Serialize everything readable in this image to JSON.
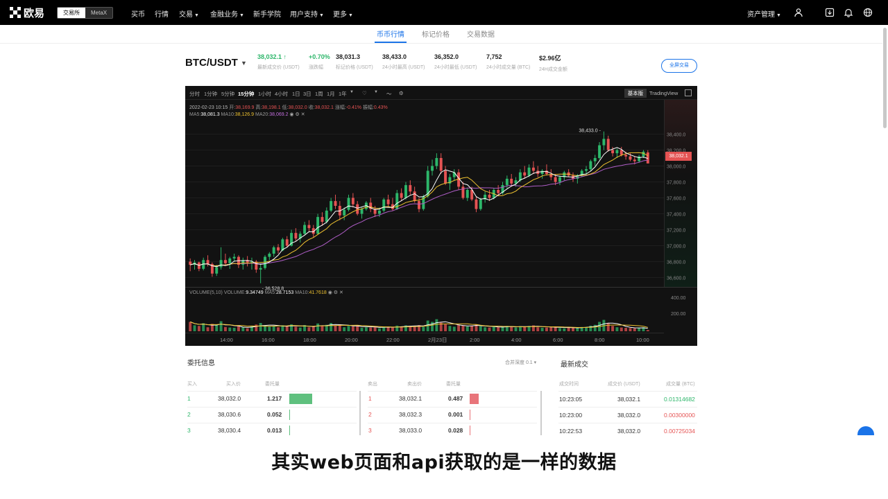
{
  "topnav": {
    "logo_text": "欧易",
    "switch": {
      "active": "交易所",
      "inactive": "MetaX"
    },
    "items": [
      "买币",
      "行情",
      "交易",
      "金融业务",
      "新手学院",
      "用户支持",
      "更多"
    ],
    "right_label": "资产管理",
    "icons": [
      "user-icon",
      "download-icon",
      "bell-icon",
      "globe-icon"
    ]
  },
  "subtabs": [
    "币币行情",
    "标记价格",
    "交易数据"
  ],
  "ticker": {
    "pair": "BTC/USDT",
    "last_price": "38,032.1 ↑",
    "last_price_label": "最新成交价 (USDT)",
    "change": "+0.70%",
    "change_label": "涨跌幅",
    "mark_price": "38,031.3",
    "mark_price_label": "标记价格 (USDT)",
    "high": "38,433.0",
    "high_label": "24小时最高 (USDT)",
    "low": "36,352.0",
    "low_label": "24小时最低 (USDT)",
    "volume_btc": "7,752",
    "volume_btc_label": "24小时成交量 (BTC)",
    "turnover": "$2.96亿",
    "turnover_label": "24H成交金额",
    "fullscreen_label": "全屏交易"
  },
  "chart": {
    "intervals": [
      "分时",
      "1分钟",
      "5分钟",
      "15分钟",
      "1小时",
      "4小时",
      "1日",
      "3日",
      "1周",
      "1月",
      "1年"
    ],
    "active_interval": "15分钟",
    "basic_label": "基本版",
    "tv_label": "TradingView",
    "ohlc_line": {
      "date": "2022-02-23 10:15",
      "open_label": "开:",
      "open": "38,169.9",
      "high_label": "高:",
      "high": "38,198.1",
      "low_label": "低:",
      "low": "38,032.0",
      "close_label": "收:",
      "close": "38,032.1",
      "chg_label": "涨幅:",
      "chg": "-0.41%",
      "amp_label": "振幅:",
      "amp": "0.43%"
    },
    "ma_line": {
      "ma5_label": "MA5:",
      "ma5": "38,081.3",
      "ma10_label": "MA10:",
      "ma10": "38,126.9",
      "ma20_label": "MA20:",
      "ma20": "38,069.2"
    },
    "vol_line": {
      "title": "VOLUME(5,10)",
      "vol_label": "VOLUME:",
      "vol": "9.34749",
      "ma5_label": "MA5:",
      "ma5": "28.7153",
      "ma10_label": "MA10:",
      "ma10": "41.7618"
    },
    "high_marker": "38,433.0",
    "low_marker": "36,528.8",
    "price_flag": "38,032.1",
    "colors": {
      "up": "#2db66a",
      "down": "#e55353",
      "ma5": "#ffffff",
      "ma10": "#f0c330",
      "ma20": "#b05ec8"
    }
  },
  "chart_data": {
    "type": "candlestick",
    "title": "",
    "price_axis_ticks": [
      "38,400.0",
      "38,200.0",
      "38,000.0",
      "37,800.0",
      "37,600.0",
      "37,400.0",
      "37,200.0",
      "37,000.0",
      "36,800.0",
      "36,600.0"
    ],
    "price_range": [
      36500,
      38500
    ],
    "volume_axis_ticks": [
      "400.00",
      "200.00"
    ],
    "volume_range": [
      0,
      500
    ],
    "time_axis_ticks": [
      "14:00",
      "16:00",
      "18:00",
      "20:00",
      "22:00",
      "2月23日",
      "2:00",
      "4:00",
      "6:00",
      "8:00",
      "10:00"
    ],
    "candles": [
      [
        36800,
        36840,
        36680,
        36760,
        70
      ],
      [
        36760,
        36820,
        36700,
        36790,
        45
      ],
      [
        36790,
        36800,
        36680,
        36710,
        40
      ],
      [
        36710,
        36850,
        36690,
        36820,
        60
      ],
      [
        36820,
        36880,
        36740,
        36770,
        30
      ],
      [
        36770,
        36790,
        36610,
        36650,
        55
      ],
      [
        36650,
        36760,
        36620,
        36730,
        48
      ],
      [
        36730,
        36980,
        36700,
        36820,
        75
      ],
      [
        36820,
        36900,
        36750,
        36780,
        32
      ],
      [
        36780,
        36860,
        36710,
        36840,
        28
      ],
      [
        36840,
        36900,
        36800,
        36860,
        26
      ],
      [
        36860,
        36880,
        36720,
        36760,
        38
      ],
      [
        36760,
        36850,
        36700,
        36820,
        30
      ],
      [
        36820,
        36870,
        36740,
        36790,
        22
      ],
      [
        36790,
        36850,
        36700,
        36800,
        40
      ],
      [
        36800,
        36820,
        36660,
        36700,
        50
      ],
      [
        36700,
        36780,
        36528.8,
        36720,
        62
      ],
      [
        36720,
        36880,
        36700,
        36860,
        44
      ],
      [
        36860,
        36920,
        36820,
        36900,
        35
      ],
      [
        36900,
        37000,
        36860,
        36980,
        40
      ],
      [
        36980,
        37020,
        36900,
        36940,
        30
      ],
      [
        36940,
        37100,
        36930,
        37080,
        45
      ],
      [
        37080,
        37120,
        36980,
        37000,
        38
      ],
      [
        37000,
        37200,
        36990,
        37160,
        52
      ],
      [
        37160,
        37220,
        37060,
        37090,
        34
      ],
      [
        37090,
        37180,
        37040,
        37150,
        28
      ],
      [
        37150,
        37300,
        37140,
        37260,
        46
      ],
      [
        37260,
        37320,
        37180,
        37220,
        30
      ],
      [
        37220,
        37260,
        37100,
        37150,
        36
      ],
      [
        37150,
        37400,
        37140,
        37360,
        58
      ],
      [
        37360,
        37420,
        37250,
        37300,
        40
      ],
      [
        37300,
        37480,
        37280,
        37440,
        48
      ],
      [
        37440,
        37600,
        37420,
        37560,
        62
      ],
      [
        37560,
        37640,
        37460,
        37500,
        44
      ],
      [
        37500,
        37560,
        37320,
        37380,
        52
      ],
      [
        37380,
        37480,
        37320,
        37450,
        30
      ],
      [
        37450,
        37640,
        37430,
        37600,
        40
      ],
      [
        37600,
        37660,
        37480,
        37520,
        36
      ],
      [
        37520,
        37560,
        37380,
        37400,
        44
      ],
      [
        37400,
        37480,
        37340,
        37460,
        26
      ],
      [
        37460,
        37560,
        37440,
        37540,
        30
      ],
      [
        37540,
        37600,
        37420,
        37460,
        28
      ],
      [
        37460,
        37500,
        37360,
        37400,
        38
      ],
      [
        37400,
        37480,
        37360,
        37440,
        22
      ],
      [
        37440,
        37600,
        37420,
        37580,
        34
      ],
      [
        37580,
        37640,
        37480,
        37520,
        30
      ],
      [
        37520,
        37600,
        37440,
        37460,
        28
      ],
      [
        37460,
        37700,
        37450,
        37660,
        42
      ],
      [
        37660,
        37720,
        37560,
        37600,
        36
      ],
      [
        37600,
        37800,
        37580,
        37760,
        44
      ],
      [
        37760,
        37820,
        37640,
        37680,
        40
      ],
      [
        37680,
        37740,
        37540,
        37560,
        38
      ],
      [
        37560,
        37600,
        37420,
        37460,
        46
      ],
      [
        37460,
        37640,
        37440,
        37620,
        34
      ],
      [
        37620,
        38000,
        37600,
        37940,
        80
      ],
      [
        37940,
        38080,
        37880,
        38000,
        70
      ],
      [
        38000,
        38160,
        37960,
        38100,
        90
      ],
      [
        38100,
        38160,
        37900,
        37940,
        64
      ],
      [
        37940,
        38000,
        37760,
        37780,
        52
      ],
      [
        37780,
        37900,
        37700,
        37860,
        40
      ],
      [
        37860,
        37960,
        37820,
        37920,
        34
      ],
      [
        37920,
        37960,
        37700,
        37740,
        48
      ],
      [
        37740,
        37800,
        37580,
        37600,
        44
      ],
      [
        37600,
        37720,
        37560,
        37700,
        36
      ],
      [
        37700,
        37740,
        37560,
        37580,
        40
      ],
      [
        37580,
        37620,
        37420,
        37460,
        52
      ],
      [
        37460,
        37600,
        37440,
        37580,
        38
      ],
      [
        37580,
        37680,
        37540,
        37640,
        30
      ],
      [
        37640,
        37700,
        37560,
        37600,
        28
      ],
      [
        37600,
        37720,
        37580,
        37700,
        34
      ],
      [
        37700,
        37760,
        37620,
        37660,
        30
      ],
      [
        37660,
        37800,
        37640,
        37760,
        36
      ],
      [
        37760,
        37880,
        37720,
        37840,
        40
      ],
      [
        37840,
        37900,
        37740,
        37780,
        32
      ],
      [
        37780,
        37860,
        37740,
        37820,
        28
      ],
      [
        37820,
        37960,
        37800,
        37920,
        38
      ],
      [
        37920,
        38000,
        37840,
        37880,
        34
      ],
      [
        37880,
        38020,
        37860,
        37980,
        40
      ],
      [
        37980,
        38060,
        37900,
        37940,
        44
      ],
      [
        37940,
        38000,
        37860,
        37900,
        30
      ],
      [
        37900,
        37960,
        37840,
        37940,
        26
      ],
      [
        37940,
        38020,
        37880,
        37900,
        28
      ],
      [
        37900,
        37960,
        37820,
        37860,
        32
      ],
      [
        37860,
        37900,
        37760,
        37800,
        36
      ],
      [
        37800,
        37880,
        37760,
        37860,
        24
      ],
      [
        37860,
        37940,
        37820,
        37920,
        22
      ],
      [
        37920,
        37960,
        37860,
        37880,
        26
      ],
      [
        37880,
        37920,
        37800,
        37840,
        30
      ],
      [
        37840,
        37900,
        37780,
        37880,
        28
      ],
      [
        37880,
        37960,
        37860,
        37940,
        32
      ],
      [
        37940,
        38000,
        37880,
        37960,
        30
      ],
      [
        37960,
        38080,
        37940,
        38060,
        42
      ],
      [
        38060,
        38140,
        38000,
        38100,
        48
      ],
      [
        38100,
        38300,
        38080,
        38260,
        70
      ],
      [
        38260,
        38433,
        38200,
        38340,
        85
      ],
      [
        38340,
        38380,
        38180,
        38200,
        60
      ],
      [
        38200,
        38240,
        38120,
        38160,
        40
      ],
      [
        38160,
        38220,
        38100,
        38200,
        30
      ],
      [
        38200,
        38240,
        38120,
        38140,
        28
      ],
      [
        38140,
        38180,
        38080,
        38120,
        26
      ],
      [
        38120,
        38160,
        38060,
        38080,
        24
      ],
      [
        38080,
        38120,
        38020,
        38060,
        22
      ],
      [
        38060,
        38140,
        38040,
        38120,
        26
      ],
      [
        38120,
        38200,
        38100,
        38180,
        30
      ],
      [
        38169.9,
        38198.1,
        38032,
        38032.1,
        9.35
      ]
    ]
  },
  "orderbook": {
    "title": "委托信息",
    "depth_label": "合并深度 0.1 ▾",
    "buy_headers": [
      "买入",
      "买入价",
      "委托量"
    ],
    "sell_headers": [
      "卖出",
      "卖出价",
      "委托量"
    ],
    "buys": [
      {
        "idx": "1",
        "price": "38,032.0",
        "qty": "1.217",
        "bar": 0.9
      },
      {
        "idx": "2",
        "price": "38,030.6",
        "qty": "0.052",
        "bar": 0.04
      },
      {
        "idx": "3",
        "price": "38,030.4",
        "qty": "0.013",
        "bar": 0.02
      }
    ],
    "sells": [
      {
        "idx": "1",
        "price": "38,032.1",
        "qty": "0.487",
        "bar": 0.36
      },
      {
        "idx": "2",
        "price": "38,032.3",
        "qty": "0.001",
        "bar": 0.02
      },
      {
        "idx": "3",
        "price": "38,033.0",
        "qty": "0.028",
        "bar": 0.04
      }
    ]
  },
  "trades": {
    "title": "最新成交",
    "headers": [
      "成交时间",
      "成交价 (USDT)",
      "成交量 (BTC)"
    ],
    "rows": [
      {
        "time": "10:23:05",
        "price": "38,032.1",
        "qty": "0.01314682",
        "side": "buy"
      },
      {
        "time": "10:23:00",
        "price": "38,032.0",
        "qty": "0.00300000",
        "side": "sell"
      },
      {
        "time": "10:22:53",
        "price": "38,032.0",
        "qty": "0.00725034",
        "side": "sell"
      }
    ]
  },
  "subtitle": "其实web页面和api获取的是一样的数据"
}
